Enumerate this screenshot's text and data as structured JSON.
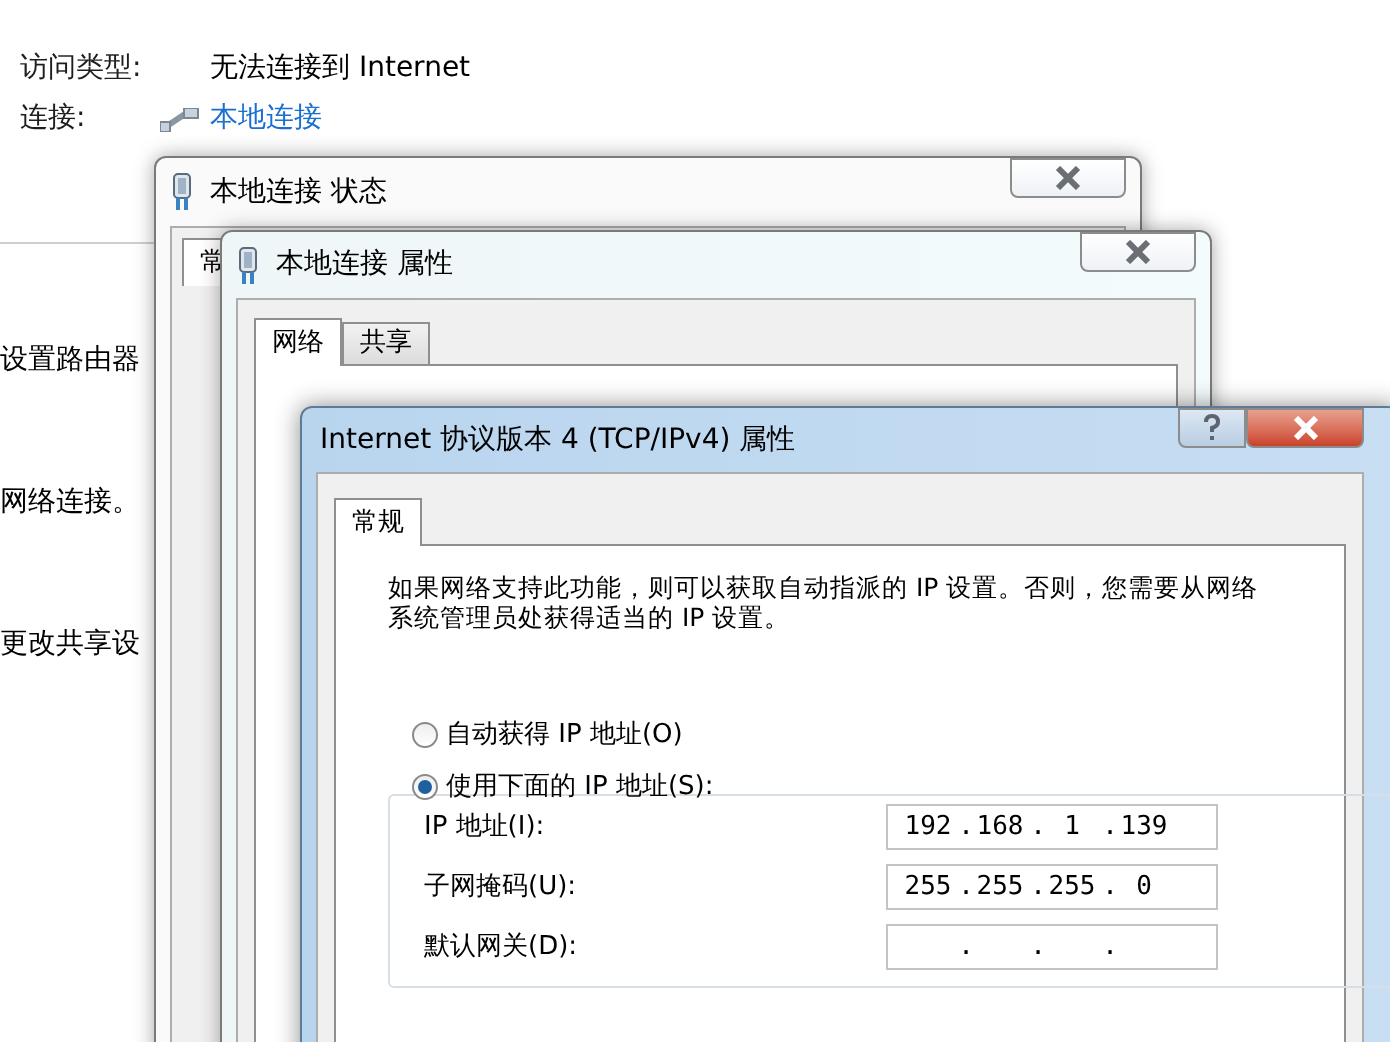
{
  "background": {
    "rows": [
      {
        "label": "访问类型:",
        "value": "无法连接到 Internet",
        "kind": "text"
      },
      {
        "label": "连接:",
        "value": "本地连接",
        "kind": "link"
      }
    ],
    "cut_texts": [
      "设置路由器",
      "网络连接。",
      "更改共享设"
    ]
  },
  "status_window": {
    "title": "本地连接 状态",
    "tabs": [
      {
        "label": "常",
        "selected": true
      }
    ]
  },
  "properties_window": {
    "title": "本地连接 属性",
    "tabs": [
      {
        "label": "网络",
        "selected": true
      },
      {
        "label": "共享",
        "selected": false
      }
    ]
  },
  "ipv4_window": {
    "title": "Internet 协议版本 4 (TCP/IPv4) 属性",
    "active": true,
    "tabs": [
      {
        "label": "常规",
        "selected": true
      }
    ],
    "description": "如果网络支持此功能，则可以获取自动指派的 IP 设置。否则，您需要从网络系统管理员处获得适当的 IP 设置。",
    "ip_options": [
      {
        "label": "自动获得 IP 地址(O)",
        "selected": false
      },
      {
        "label": "使用下面的 IP 地址(S):",
        "selected": true
      }
    ],
    "separator": ".",
    "fields": [
      {
        "label": "IP 地址(I):",
        "octets": [
          "192",
          "168",
          "1",
          "139"
        ]
      },
      {
        "label": "子网掩码(U):",
        "octets": [
          "255",
          "255",
          "255",
          "0"
        ]
      },
      {
        "label": "默认网关(D):"
      }
    ]
  }
}
